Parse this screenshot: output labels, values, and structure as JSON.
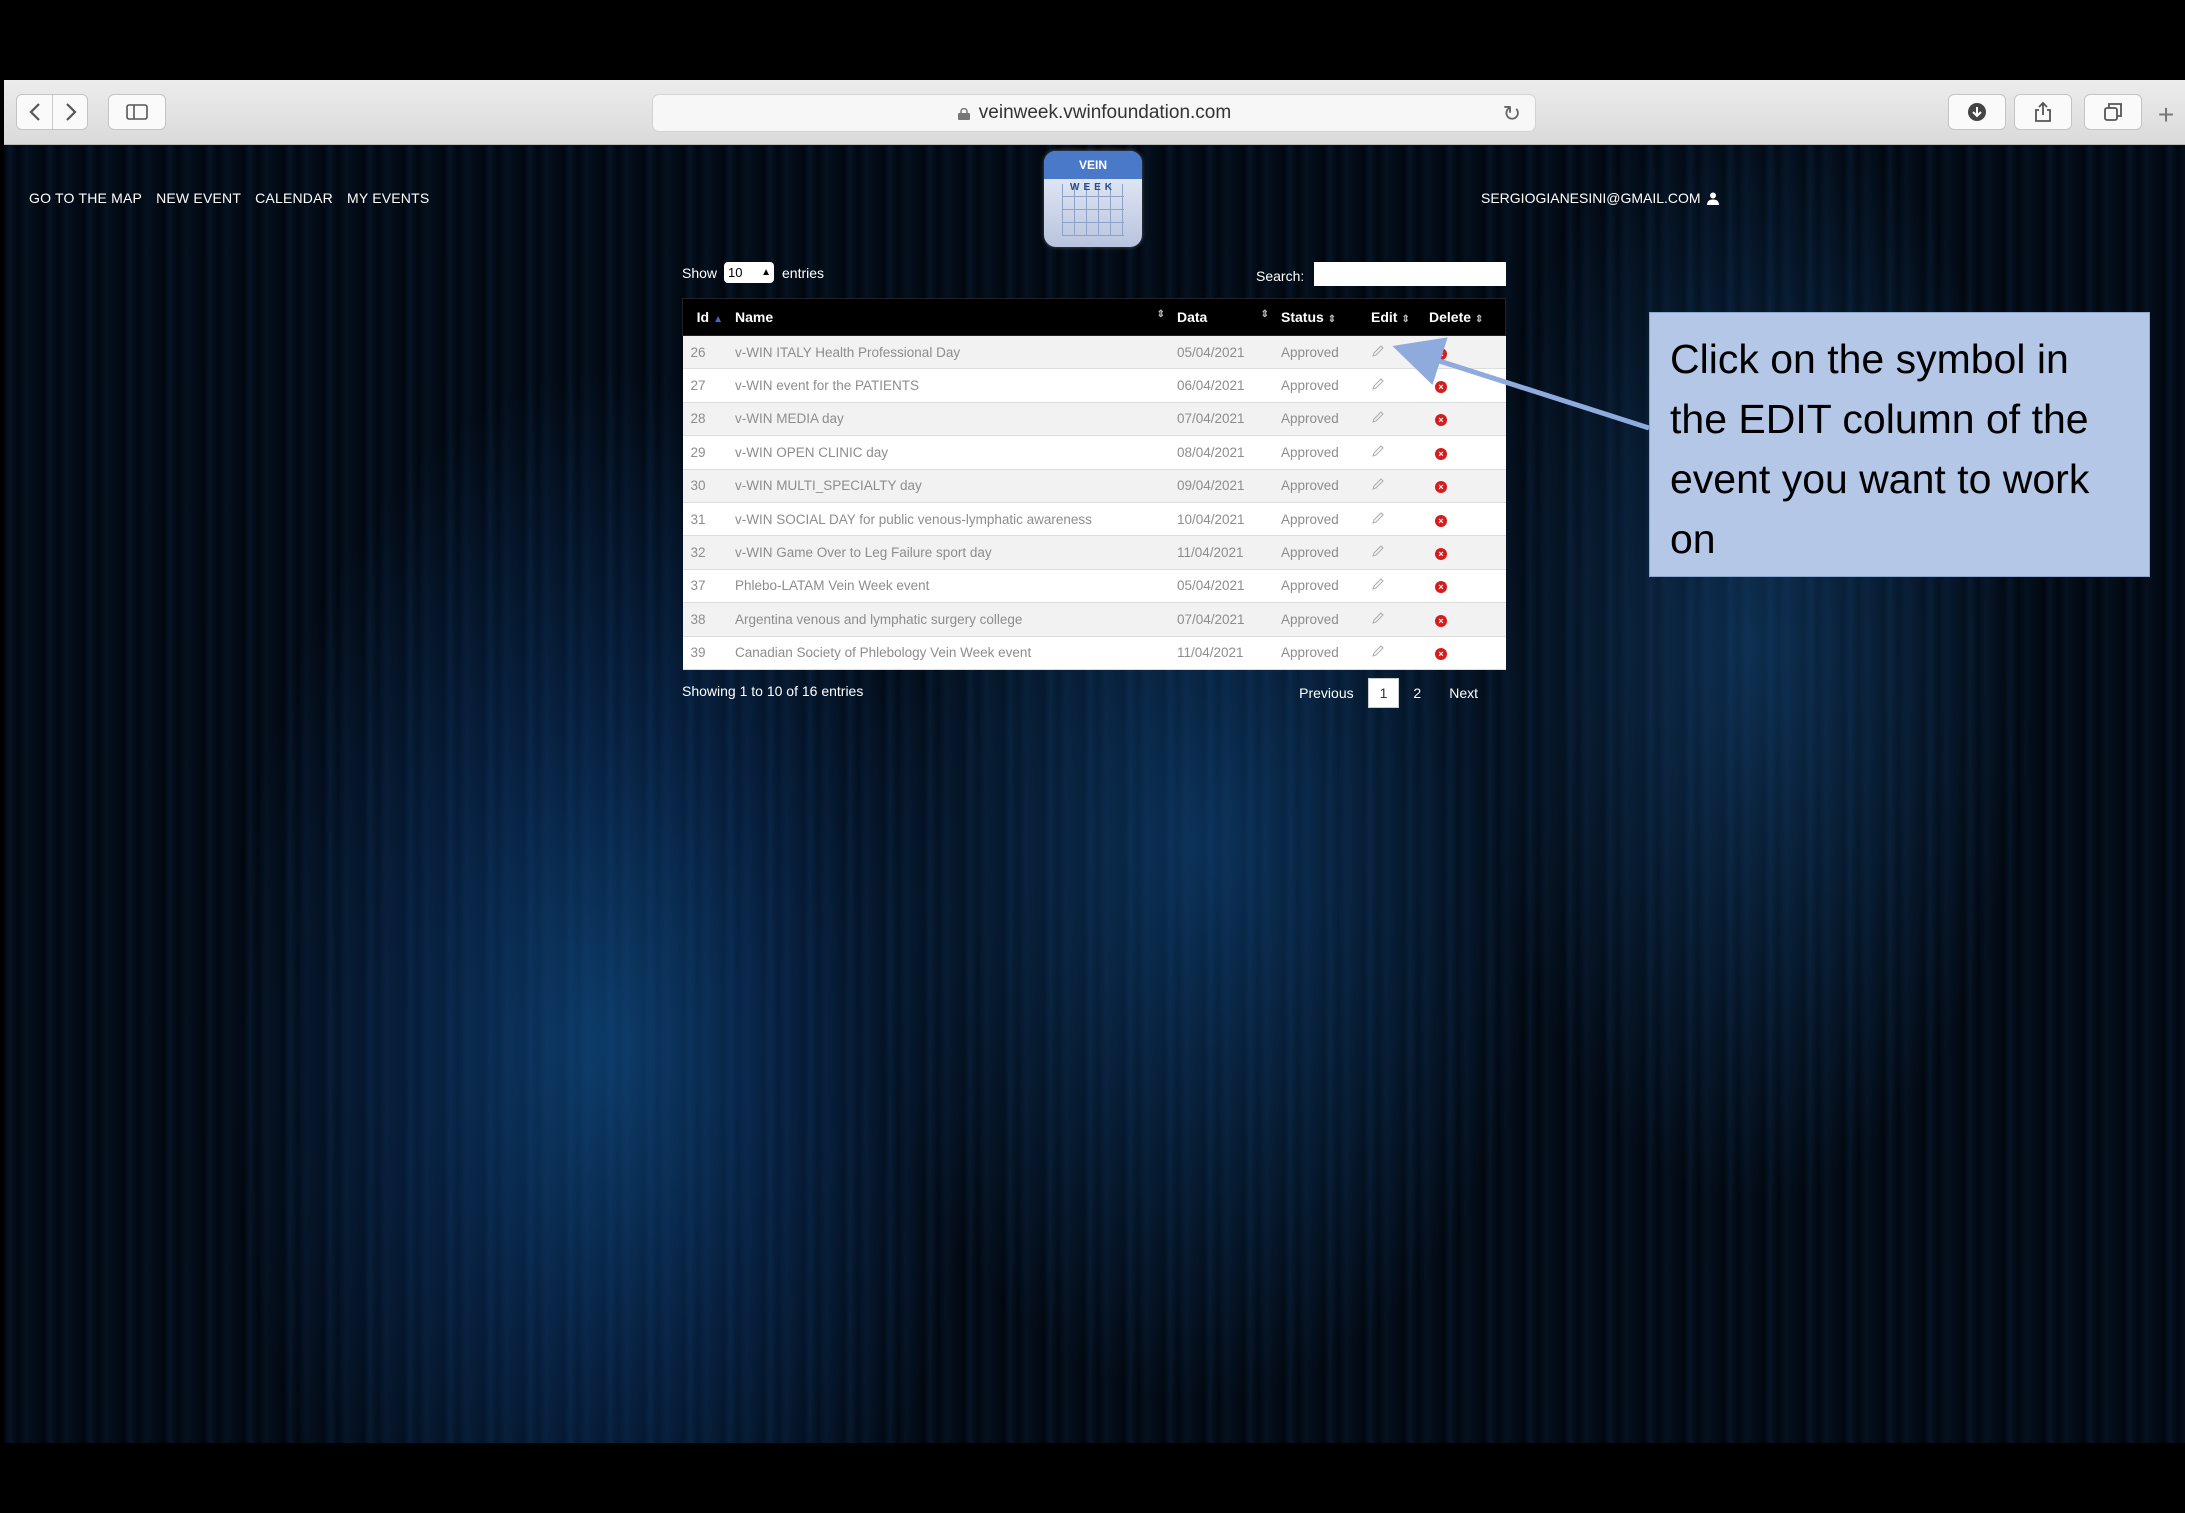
{
  "browser": {
    "url": "veinweek.vwinfoundation.com",
    "icons": [
      "back-icon",
      "forward-icon",
      "sidebar-icon",
      "lock-icon",
      "reload-icon",
      "download-icon",
      "share-icon",
      "tabs-icon",
      "new-tab-icon"
    ]
  },
  "nav": {
    "items": [
      "GO TO THE MAP",
      "NEW EVENT",
      "CALENDAR",
      "MY EVENTS"
    ]
  },
  "logo": {
    "text": "VEIN",
    "subtext": "WEEK"
  },
  "user": {
    "email": "SERGIOGIANESINI@GMAIL.COM"
  },
  "table_controls": {
    "show_label": "Show",
    "length_value": "10",
    "entries_label": "entries",
    "search_label": "Search:",
    "search_value": ""
  },
  "table": {
    "columns": [
      "Id",
      "Name",
      "Data",
      "Status",
      "Edit",
      "Delete"
    ],
    "rows": [
      {
        "id": "26",
        "name": "v-WIN ITALY Health Professional Day",
        "date": "05/04/2021",
        "status": "Approved"
      },
      {
        "id": "27",
        "name": "v-WIN event for the PATIENTS",
        "date": "06/04/2021",
        "status": "Approved"
      },
      {
        "id": "28",
        "name": "v-WIN MEDIA day",
        "date": "07/04/2021",
        "status": "Approved"
      },
      {
        "id": "29",
        "name": "v-WIN OPEN CLINIC day",
        "date": "08/04/2021",
        "status": "Approved"
      },
      {
        "id": "30",
        "name": "v-WIN MULTI_SPECIALTY day",
        "date": "09/04/2021",
        "status": "Approved"
      },
      {
        "id": "31",
        "name": "v-WIN SOCIAL DAY for public venous-lymphatic awareness",
        "date": "10/04/2021",
        "status": "Approved"
      },
      {
        "id": "32",
        "name": "v-WIN Game Over to Leg Failure sport day",
        "date": "11/04/2021",
        "status": "Approved"
      },
      {
        "id": "37",
        "name": "Phlebo-LATAM Vein Week event",
        "date": "05/04/2021",
        "status": "Approved"
      },
      {
        "id": "38",
        "name": "Argentina venous and lymphatic surgery college",
        "date": "07/04/2021",
        "status": "Approved"
      },
      {
        "id": "39",
        "name": "Canadian Society of Phlebology Vein Week event",
        "date": "11/04/2021",
        "status": "Approved"
      }
    ]
  },
  "footer": {
    "info": "Showing 1 to 10 of 16 entries",
    "previous": "Previous",
    "pages": [
      "1",
      "2"
    ],
    "current_page": "1",
    "next": "Next"
  },
  "callout": {
    "text": "Click on the symbol in the EDIT column of the event you want to work on",
    "color": "#b4c7e7",
    "arrow_color": "#8faadc"
  }
}
